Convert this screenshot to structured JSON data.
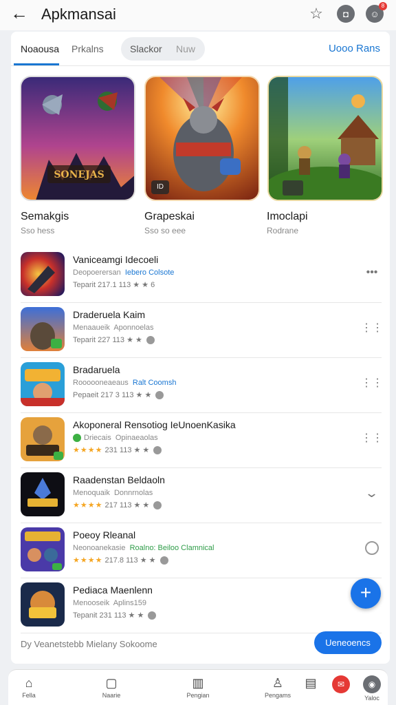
{
  "header": {
    "back_icon": "arrow-left-icon",
    "title": "Apkmansai",
    "icons": [
      "star-icon",
      "profile-icon",
      "notification-icon"
    ]
  },
  "tabs": {
    "items": [
      "Noaousa",
      "Prkalns",
      "Slackor",
      "Nuw"
    ],
    "active": 0,
    "right_link": "Uooo Rans"
  },
  "featured": [
    {
      "label": "Semakgis",
      "sub": "Sso hess",
      "art_text": "SONEJAS"
    },
    {
      "label": "Grapeskai",
      "sub": "Sso so eee",
      "badge": "ID"
    },
    {
      "label": "Imoclapi",
      "sub": "Rodrane"
    }
  ],
  "apps": [
    {
      "title": "Vaniceamgi Idecoeli",
      "meta_left": "Deopoerersan",
      "meta_hl": "Iebero Colsote",
      "stats": "Teparit 217.1 113 ★ ★ 6",
      "action": "more-dots-icon"
    },
    {
      "title": "Draderuela Kaim",
      "meta_left": "Menaaueik",
      "meta_hl": "Aponnoelas",
      "stats": "Teparit 227 113 ★ ★ ",
      "action": "grid-dots-icon"
    },
    {
      "title": "Bradaruela",
      "meta_left": "Roooooneaeaus",
      "meta_hl": "Ralt Coomsh",
      "stats": "Pepaeit 217 3 113 ★ ★ ",
      "action": "grid-dots-icon"
    },
    {
      "title": "Akoponeral Rensotiog IeUnoenKasika",
      "meta_left": "Driecais",
      "meta_hl": "Opinaeaolas",
      "stats": "231 113 ★ ★ ",
      "stars": "★★★★",
      "action": "grid-dots-icon"
    },
    {
      "title": "Raadenstan Beldaoln",
      "meta_left": "Menoquaik",
      "meta_hl": "Donnrnolas",
      "stats": "217 113 ★ ★ ",
      "stars": "★★★★",
      "action": "chevron-down-icon"
    },
    {
      "title": "Poeoy Rleanal",
      "meta_left": "Neonoanekasie",
      "meta_hl": "Roalno: Beiloo Clamnical",
      "stats": "217.8 113 ★ ★ ",
      "stars": "★★★★",
      "action": "circle-icon"
    },
    {
      "title": "Pediaca Maenlenn",
      "meta_left": "Menooseik",
      "meta_hl": "Aplins159",
      "stats": "Tepanit 231 113 ★ ★ ",
      "action": "none"
    }
  ],
  "footer": {
    "text": "Dy Veanetstebb Mielany Sokoome",
    "button": "Ueneoencs"
  },
  "fab": "+",
  "bottom_nav": [
    {
      "label": "Fella",
      "icon": "home-icon"
    },
    {
      "label": "Naarie",
      "icon": "chat-icon"
    },
    {
      "label": "Pengian",
      "icon": "book-icon"
    },
    {
      "label": "Pengams",
      "icon": "person-icon"
    },
    {
      "label": "",
      "icon": "list-icon"
    },
    {
      "label": "",
      "icon": "red-app-icon"
    },
    {
      "label": "Yaloc",
      "icon": "settings-icon"
    }
  ]
}
